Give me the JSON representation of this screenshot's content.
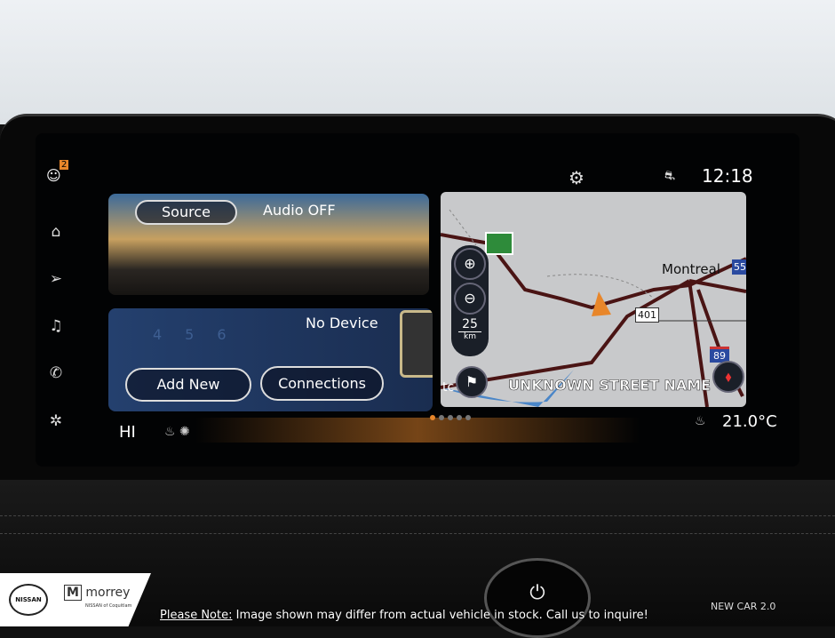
{
  "status": {
    "time": "12:18",
    "notification_count": "2"
  },
  "sidebar": {
    "items": [
      {
        "icon": "profile-icon"
      },
      {
        "icon": "home-icon"
      },
      {
        "icon": "navigation-icon"
      },
      {
        "icon": "music-icon"
      },
      {
        "icon": "phone-icon"
      },
      {
        "icon": "climate-fan-icon"
      }
    ]
  },
  "audio": {
    "source_label": "Source",
    "status": "Audio OFF"
  },
  "phone": {
    "status": "No Device",
    "add_new_label": "Add New",
    "connections_label": "Connections"
  },
  "map": {
    "city": "Montreal",
    "highway_401": "401",
    "interstate_55": "55",
    "interstate_89": "89",
    "scale_value": "25",
    "scale_unit": "km",
    "street": "UNKNOWN STREET NAME",
    "partial_label": "tc"
  },
  "climate": {
    "fan": "HI",
    "temperature": "21.0°C"
  },
  "pager": {
    "pages": 5,
    "active": 0
  },
  "footer": {
    "dealer": "morrey",
    "dealer_sub": "NISSAN of Coquitlam",
    "brand": "NISSAN",
    "note_prefix": "Please Note:",
    "note": " Image shown may differ from actual vehicle in stock. Call us to inquire!",
    "badge": "NEW CAR 2.0"
  },
  "colors": {
    "accent": "#e8862a",
    "road": "#4a1414",
    "water": "#4a86c8"
  }
}
